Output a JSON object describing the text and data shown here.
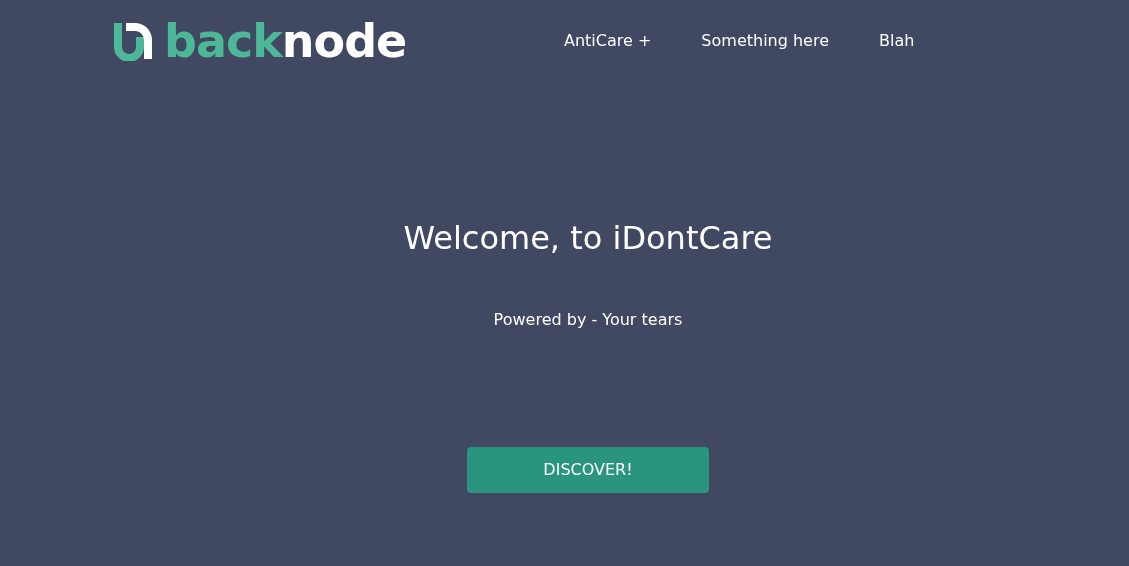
{
  "logo": {
    "part_1": "back",
    "part_2": "node"
  },
  "nav": [
    {
      "label": "AntiCare +"
    },
    {
      "label": "Something here"
    },
    {
      "label": "Blah"
    }
  ],
  "hero": {
    "title": "Welcome, to iDontCare",
    "subtitle": "Powered by - Your tears",
    "button": "DISCOVER!"
  }
}
